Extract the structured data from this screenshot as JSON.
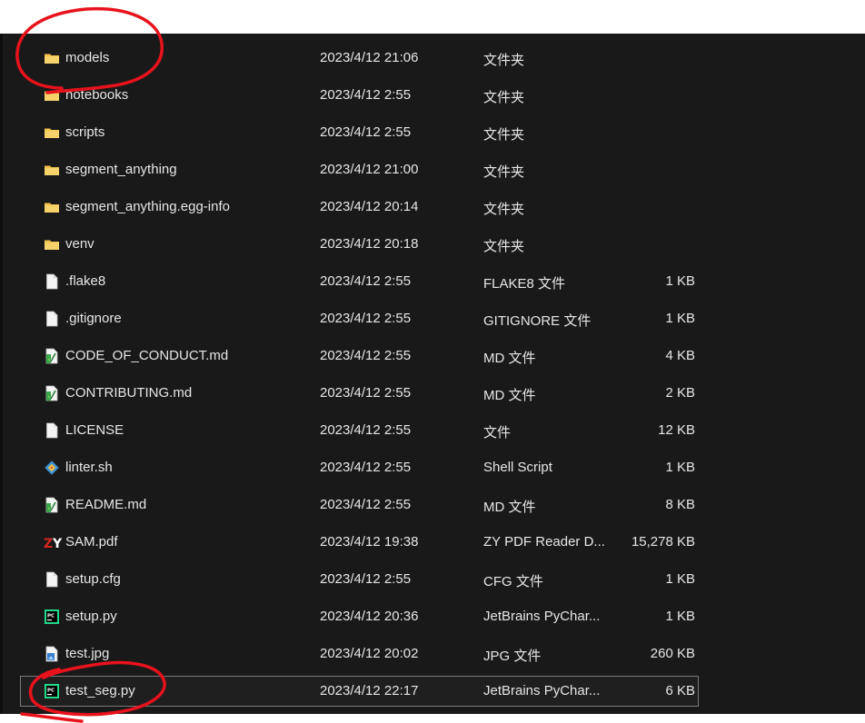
{
  "files": [
    {
      "name": "models",
      "date": "2023/4/12 21:06",
      "type": "文件夹",
      "size": "",
      "icon": "folder-icon"
    },
    {
      "name": "notebooks",
      "date": "2023/4/12 2:55",
      "type": "文件夹",
      "size": "",
      "icon": "folder-icon"
    },
    {
      "name": "scripts",
      "date": "2023/4/12 2:55",
      "type": "文件夹",
      "size": "",
      "icon": "folder-icon"
    },
    {
      "name": "segment_anything",
      "date": "2023/4/12 21:00",
      "type": "文件夹",
      "size": "",
      "icon": "folder-icon"
    },
    {
      "name": "segment_anything.egg-info",
      "date": "2023/4/12 20:14",
      "type": "文件夹",
      "size": "",
      "icon": "folder-icon"
    },
    {
      "name": "venv",
      "date": "2023/4/12 20:18",
      "type": "文件夹",
      "size": "",
      "icon": "folder-icon"
    },
    {
      "name": ".flake8",
      "date": "2023/4/12 2:55",
      "type": "FLAKE8 文件",
      "size": "1 KB",
      "icon": "file-icon"
    },
    {
      "name": ".gitignore",
      "date": "2023/4/12 2:55",
      "type": "GITIGNORE 文件",
      "size": "1 KB",
      "icon": "file-icon"
    },
    {
      "name": "CODE_OF_CONDUCT.md",
      "date": "2023/4/12 2:55",
      "type": "MD 文件",
      "size": "4 KB",
      "icon": "markdown-file-icon"
    },
    {
      "name": "CONTRIBUTING.md",
      "date": "2023/4/12 2:55",
      "type": "MD 文件",
      "size": "2 KB",
      "icon": "markdown-file-icon"
    },
    {
      "name": "LICENSE",
      "date": "2023/4/12 2:55",
      "type": "文件",
      "size": "12 KB",
      "icon": "file-icon"
    },
    {
      "name": "linter.sh",
      "date": "2023/4/12 2:55",
      "type": "Shell Script",
      "size": "1 KB",
      "icon": "shell-script-icon"
    },
    {
      "name": "README.md",
      "date": "2023/4/12 2:55",
      "type": "MD 文件",
      "size": "8 KB",
      "icon": "markdown-file-icon"
    },
    {
      "name": "SAM.pdf",
      "date": "2023/4/12 19:38",
      "type": "ZY PDF Reader D...",
      "size": "15,278 KB",
      "icon": "pdf-reader-icon"
    },
    {
      "name": "setup.cfg",
      "date": "2023/4/12 2:55",
      "type": "CFG 文件",
      "size": "1 KB",
      "icon": "file-icon"
    },
    {
      "name": "setup.py",
      "date": "2023/4/12 20:36",
      "type": "JetBrains PyChar...",
      "size": "1 KB",
      "icon": "pycharm-file-icon"
    },
    {
      "name": "test.jpg",
      "date": "2023/4/12 20:02",
      "type": "JPG 文件",
      "size": "260 KB",
      "icon": "image-file-icon"
    },
    {
      "name": "test_seg.py",
      "date": "2023/4/12 22:17",
      "type": "JetBrains PyChar...",
      "size": "6 KB",
      "icon": "pycharm-file-icon"
    }
  ],
  "selected_file": "test_seg.py",
  "colors": {
    "background": "#191919",
    "text": "#e6e6e6",
    "folder": "#f0c24a",
    "annotation": "#e8121c",
    "selection_border": "#7a7a7a"
  }
}
